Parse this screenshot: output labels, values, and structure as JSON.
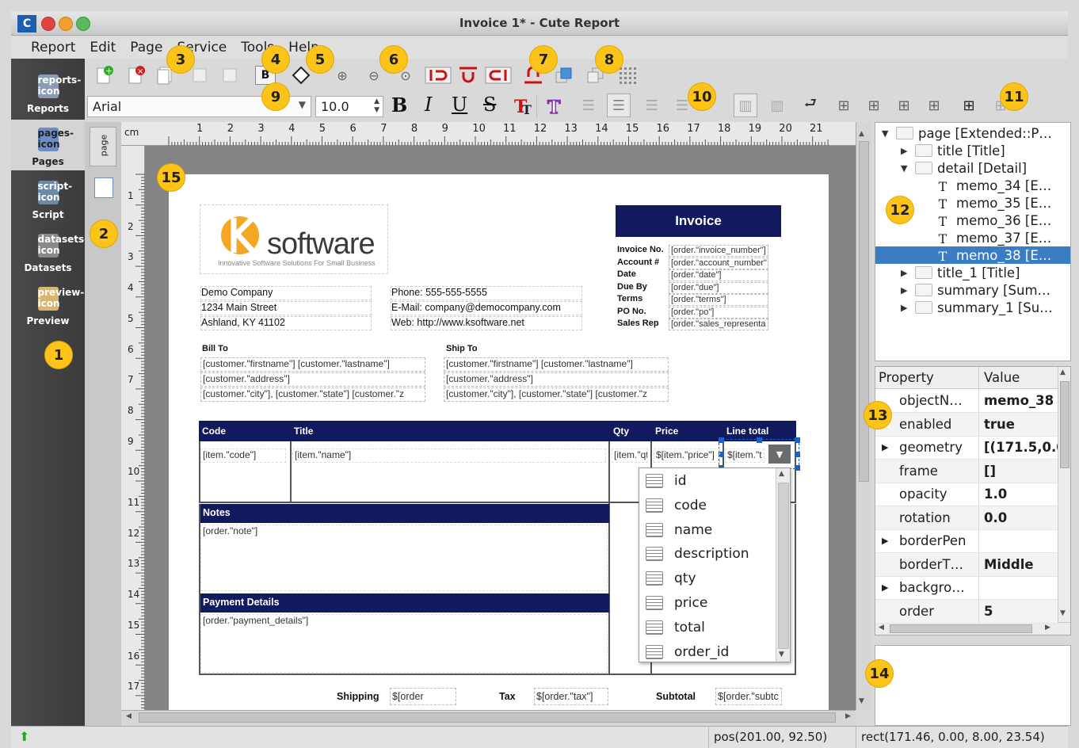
{
  "window": {
    "title": "Invoice 1* - Cute Report",
    "logo": "C"
  },
  "menu": [
    "Report",
    "Edit",
    "Page",
    "Service",
    "Tools",
    "Help"
  ],
  "modes": [
    {
      "label": "Reports",
      "icon": "reports-icon"
    },
    {
      "label": "Pages",
      "icon": "pages-icon"
    },
    {
      "label": "Script",
      "icon": "script-icon"
    },
    {
      "label": "Datasets",
      "icon": "datasets-icon"
    },
    {
      "label": "Preview",
      "icon": "preview-icon"
    }
  ],
  "page_tab": "page",
  "format": {
    "font": "Arial",
    "size": "10.0",
    "bold": "B",
    "italic": "I",
    "underline": "U",
    "strike": "S"
  },
  "ruler": {
    "unit": "cm",
    "h": [
      "1",
      "2",
      "3",
      "4",
      "5",
      "6",
      "7",
      "8",
      "9",
      "10",
      "11",
      "12",
      "13",
      "14",
      "15",
      "16",
      "17",
      "18",
      "19",
      "20",
      "21"
    ],
    "v": [
      "1",
      "2",
      "3",
      "4",
      "5",
      "6",
      "7",
      "8",
      "9",
      "10",
      "11",
      "12",
      "13",
      "14",
      "15",
      "16",
      "17"
    ]
  },
  "badges": [
    "1",
    "2",
    "3",
    "4",
    "5",
    "6",
    "7",
    "8",
    "9",
    "10",
    "11",
    "12",
    "13",
    "14",
    "15"
  ],
  "report": {
    "logo_name": "software",
    "logo_tag": "Innovative Software Solutions For Small Business",
    "logo_k": "k",
    "invoice_title": "Invoice",
    "company": [
      "Demo Company",
      "1234 Main Street",
      "Ashland, KY 41102"
    ],
    "contact": [
      "Phone:  555-555-5555",
      "E-Mail: company@democompany.com",
      "Web: http://www.ksoftware.net"
    ],
    "inv_labels": [
      "Invoice No.",
      "Account #",
      "Date",
      "Due By",
      "Terms",
      "PO No.",
      "Sales Rep"
    ],
    "inv_fields": [
      "[order.\"invoice_number\"]",
      "[order.\"account_number\"",
      "[order.\"date\"]",
      "[order.\"due\"]",
      "[order.\"terms\"]",
      "[order.\"po\"]",
      "[order.\"sales_representa"
    ],
    "bill_to": "Bill To",
    "ship_to": "Ship To",
    "bill_lines": [
      "[customer.\"firstname\"] [customer.\"lastname\"]",
      "[customer.\"address\"]",
      "[customer.\"city\"], [customer.\"state\"] [customer.\"z"
    ],
    "ship_lines": [
      "[customer.\"firstname\"] [customer.\"lastname\"]",
      "[customer.\"address\"]",
      "[customer.\"city\"], [customer.\"state\"] [customer.\"z"
    ],
    "cols": [
      "Code",
      "Title",
      "Qty",
      "Price",
      "Line total"
    ],
    "row": [
      "[item.\"code\"]",
      "[item.\"name\"]",
      "[item.\"qt",
      "$[item.\"price\"]",
      "$[item.\"t"
    ],
    "notes_label": "Notes",
    "notes_field": "[order.\"note\"]",
    "pay_label": "Payment Details",
    "pay_field": "[order.\"payment_details\"]",
    "footer": [
      {
        "label": "Shipping",
        "field": "$[order"
      },
      {
        "label": "Tax",
        "field": "$[order.\"tax\"]"
      },
      {
        "label": "Subtotal",
        "field": "$[order.\"subtc"
      }
    ]
  },
  "dropdown": [
    "id",
    "code",
    "name",
    "description",
    "qty",
    "price",
    "total",
    "order_id"
  ],
  "tree": [
    {
      "label": "page [Extended::P…",
      "indent": 0,
      "arrow": "▼"
    },
    {
      "label": "title [Title]",
      "indent": 1,
      "arrow": "▶"
    },
    {
      "label": "detail [Detail]",
      "indent": 1,
      "arrow": "▼"
    },
    {
      "label": "memo_34 [E…",
      "indent": 2,
      "arrow": ""
    },
    {
      "label": "memo_35 [E…",
      "indent": 2,
      "arrow": ""
    },
    {
      "label": "memo_36 [E…",
      "indent": 2,
      "arrow": ""
    },
    {
      "label": "memo_37 [E…",
      "indent": 2,
      "arrow": ""
    },
    {
      "label": "memo_38 [E…",
      "indent": 2,
      "arrow": "",
      "selected": true
    },
    {
      "label": "title_1 [Title]",
      "indent": 1,
      "arrow": "▶"
    },
    {
      "label": "summary [Sum…",
      "indent": 1,
      "arrow": "▶"
    },
    {
      "label": "summary_1 [Su…",
      "indent": 1,
      "arrow": "▶"
    }
  ],
  "props": {
    "headers": [
      "Property",
      "Value"
    ],
    "rows": [
      {
        "name": "objectN…",
        "value": "memo_38",
        "arrow": ""
      },
      {
        "name": "enabled",
        "value": "true",
        "arrow": ""
      },
      {
        "name": "geometry",
        "value": "[(171.5,0.0",
        "arrow": "▶"
      },
      {
        "name": "frame",
        "value": "[]",
        "arrow": ""
      },
      {
        "name": "opacity",
        "value": "1.0",
        "arrow": ""
      },
      {
        "name": "rotation",
        "value": "0.0",
        "arrow": ""
      },
      {
        "name": "borderPen",
        "value": "",
        "arrow": "▶"
      },
      {
        "name": "borderT…",
        "value": "Middle",
        "arrow": ""
      },
      {
        "name": "backgro…",
        "value": "",
        "arrow": "▶"
      },
      {
        "name": "order",
        "value": "5",
        "arrow": ""
      }
    ]
  },
  "status": {
    "pos": "pos(201.00, 92.50)",
    "rect": "rect(171.46, 0.00, 8.00, 23.54)"
  }
}
